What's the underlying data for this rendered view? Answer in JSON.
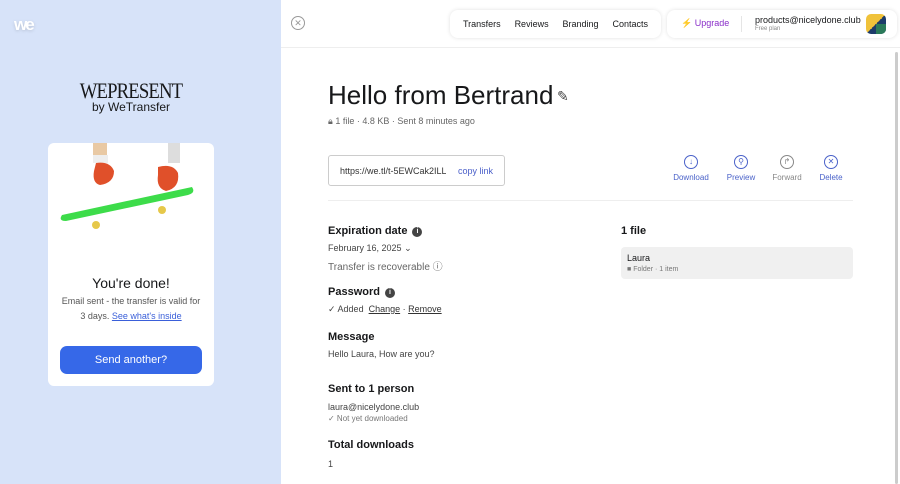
{
  "brand": {
    "logo": "we",
    "wepresent": "WEPRESENT",
    "by": "by WeTransfer"
  },
  "card": {
    "title": "You're done!",
    "text": "Email sent - the transfer is valid for 3 days.",
    "link": "See what's inside",
    "button": "Send another?"
  },
  "nav": {
    "items": [
      "Transfers",
      "Reviews",
      "Branding",
      "Contacts"
    ],
    "upgrade": "Upgrade",
    "email": "products@nicelydone.club",
    "plan": "Free plan"
  },
  "transfer": {
    "title": "Hello from Bertrand",
    "meta": "1 file · 4.8 KB · Sent 8 minutes ago",
    "url": "https://we.tl/t-5EWCak2ILL",
    "copy": "copy link",
    "actions": [
      "Download",
      "Preview",
      "Forward",
      "Delete"
    ],
    "expiration_label": "Expiration date",
    "expiration_date": "February 16, 2025",
    "recoverable": "Transfer is recoverable",
    "password_label": "Password",
    "password_status": "✓ Added",
    "change": "Change",
    "remove": "Remove",
    "message_label": "Message",
    "message": "Hello Laura, How are you?",
    "sent_label": "Sent to 1 person",
    "recipient": "laura@nicelydone.club",
    "recipient_status": "✓ Not yet downloaded",
    "downloads_label": "Total downloads",
    "downloads": "1",
    "files_label": "1 file",
    "file_name": "Laura",
    "file_meta": "Folder · 1 item"
  },
  "colors": {
    "accent": "#3668e8",
    "upgrade": "#8a2fc9",
    "sidebar": "#d7e3f9"
  }
}
